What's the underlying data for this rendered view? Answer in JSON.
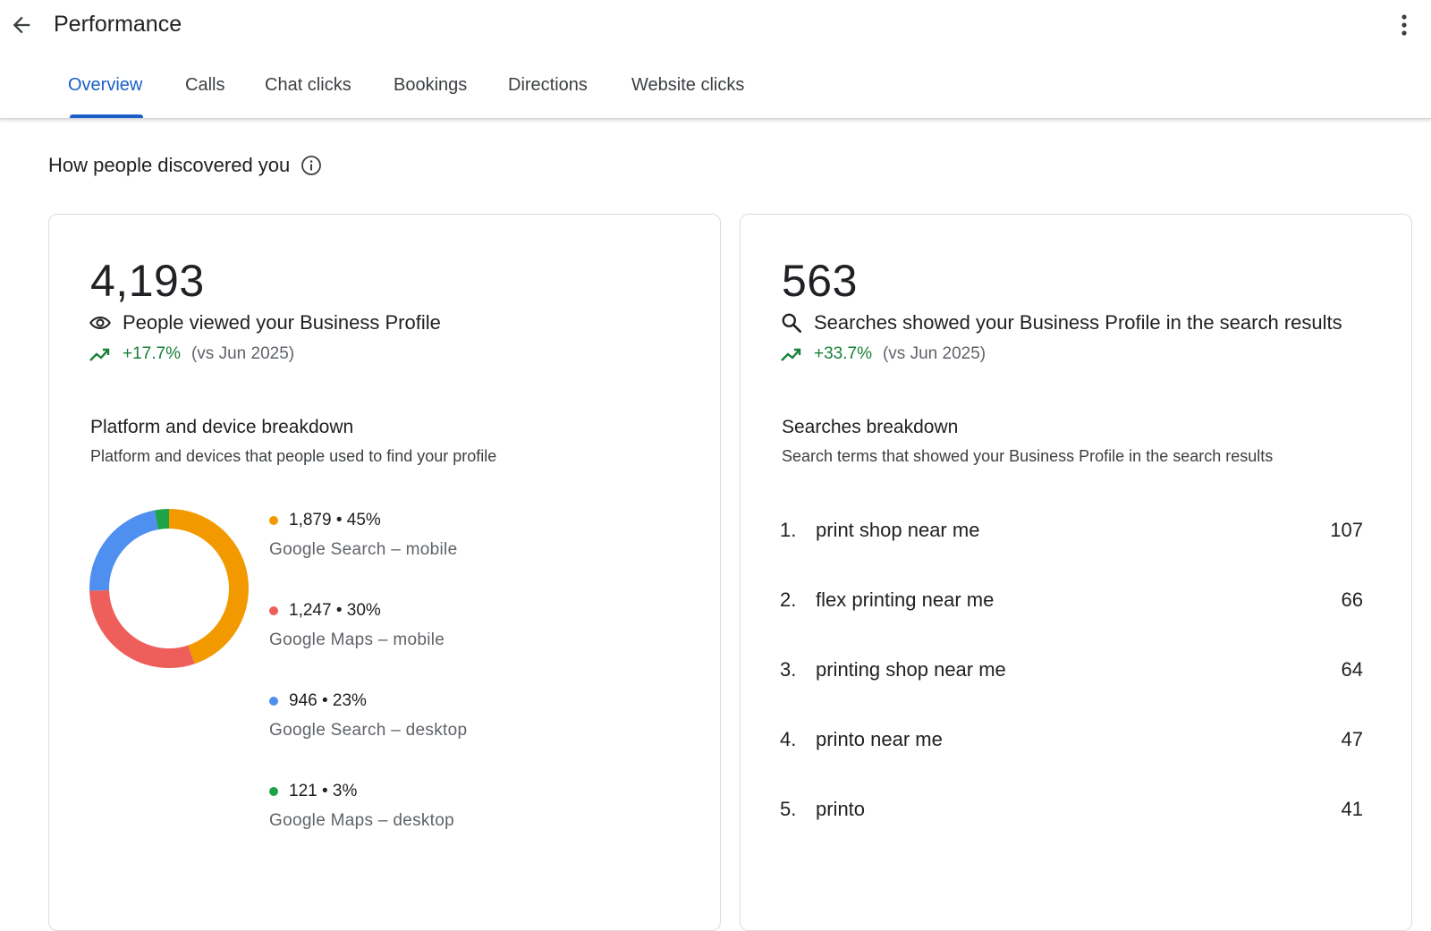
{
  "header": {
    "title": "Performance",
    "back_icon": "arrow-back-icon",
    "more_icon": "more-vert-icon"
  },
  "tabs": [
    {
      "label": "Overview",
      "active": true
    },
    {
      "label": "Calls",
      "active": false
    },
    {
      "label": "Chat clicks",
      "active": false
    },
    {
      "label": "Bookings",
      "active": false
    },
    {
      "label": "Directions",
      "active": false
    },
    {
      "label": "Website clicks",
      "active": false
    }
  ],
  "section": {
    "title": "How people discovered you",
    "info_icon": "info-icon"
  },
  "profile_views": {
    "total": "4,193",
    "label": "People viewed your Business Profile",
    "icon": "eye-icon",
    "trend": "+17.7%",
    "compare": "(vs Jun 2025)",
    "breakdown_title": "Platform and device breakdown",
    "breakdown_desc": "Platform and devices that people used to find your profile",
    "segments": [
      {
        "stat": "1,879 • 45%",
        "name": "Google Search – mobile",
        "color": "#f29900",
        "value": 1879
      },
      {
        "stat": "1,247 • 30%",
        "name": "Google Maps – mobile",
        "color": "#ee5e5b",
        "value": 1247
      },
      {
        "stat": "946 • 23%",
        "name": "Google Search – desktop",
        "color": "#4f8ff0",
        "value": 946
      },
      {
        "stat": "121 • 3%",
        "name": "Google Maps – desktop",
        "color": "#1ea446",
        "value": 121
      }
    ]
  },
  "searches": {
    "total": "563",
    "label": "Searches showed your Business Profile in the search results",
    "icon": "search-icon",
    "trend": "+33.7%",
    "compare": "(vs Jun 2025)",
    "breakdown_title": "Searches breakdown",
    "breakdown_desc": "Search terms that showed your Business Profile in the search results",
    "terms": [
      {
        "rank": "1.",
        "term": "print shop near me",
        "count": "107"
      },
      {
        "rank": "2.",
        "term": "flex printing near me",
        "count": "66"
      },
      {
        "rank": "3.",
        "term": "printing shop near me",
        "count": "64"
      },
      {
        "rank": "4.",
        "term": "printo near me",
        "count": "47"
      },
      {
        "rank": "5.",
        "term": "printo",
        "count": "41"
      }
    ]
  },
  "colors": {
    "accent": "#1a5fc7",
    "trend_up": "#188038"
  }
}
